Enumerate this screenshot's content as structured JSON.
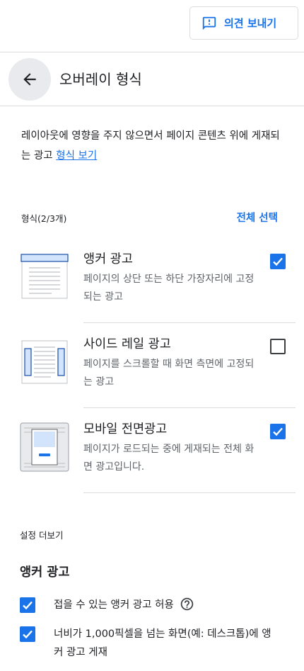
{
  "topbar": {
    "feedback_label": "의견 보내기"
  },
  "header": {
    "title": "오버레이 형식"
  },
  "description": {
    "text": "레이아웃에 영향을 주지 않으면서 페이지 콘텐츠 위에 게재되는 광고 ",
    "link": "형식 보기"
  },
  "formats": {
    "label": "형식(2/3개)",
    "select_all": "전체 선택",
    "items": [
      {
        "title": "앵커 광고",
        "desc": "페이지의 상단 또는 하단 가장자리에 고정되는 광고",
        "checked": true
      },
      {
        "title": "사이드 레일 광고",
        "desc": "페이지를 스크롤할 때 화면 측면에 고정되는 광고",
        "checked": false
      },
      {
        "title": "모바일 전면광고",
        "desc": "페이지가 로드되는 중에 게재되는 전체 화면 광고입니다.",
        "checked": true
      }
    ]
  },
  "more_settings": {
    "label": "설정 더보기",
    "anchor_heading": "앵커 광고",
    "options": [
      {
        "text": "접을 수 있는 앵커 광고 허용",
        "checked": true
      },
      {
        "text": "너비가 1,000픽셀을 넘는 화면(예: 데스크톱)에 앵커 광고 게재",
        "checked": true
      }
    ]
  },
  "colors": {
    "accent": "#1a73e8",
    "text": "#202124",
    "secondary_text": "#5f6368",
    "divider": "#dadce0"
  },
  "icons": [
    "feedback-icon",
    "back-arrow-icon",
    "checkbox-icon",
    "help-icon"
  ]
}
